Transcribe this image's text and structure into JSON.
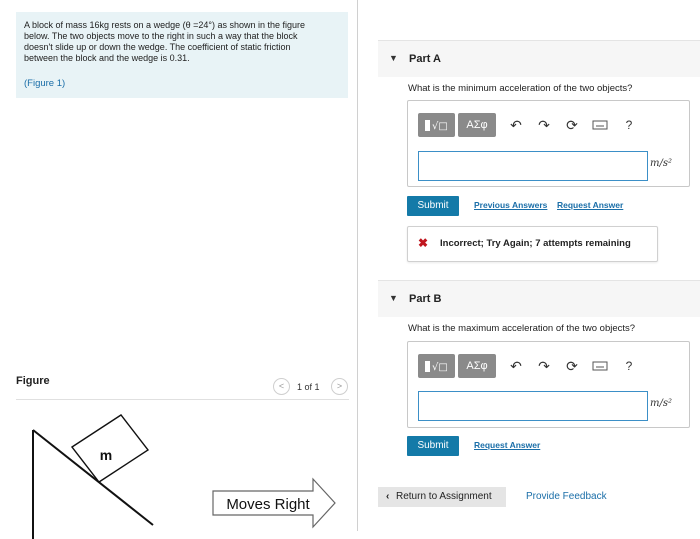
{
  "problem": {
    "text_lines": [
      "A block of mass 16kg rests on a wedge (θ =24°) as shown in the figure",
      "below.  The two objects move to the right in such a way that the block",
      "doesn't slide up or down the wedge.  The coefficient of static friction",
      "between the block and the wedge is 0.31."
    ],
    "figure_link": "(Figure 1)"
  },
  "toolbar": {
    "templates_icon": "templates-icon",
    "greek_label": "ΑΣφ",
    "undo_icon": "undo-icon",
    "redo_icon": "redo-icon",
    "reset_icon": "reset-icon",
    "keyboard_icon": "keyboard-icon",
    "help_label": "?"
  },
  "part_a": {
    "title": "Part A",
    "question": "What is the minimum acceleration of the two objects?",
    "unit": "m/s²",
    "input_value": "",
    "submit_label": "Submit",
    "previous_answers": "Previous Answers",
    "request_answer": "Request Answer",
    "feedback_mark": "✖",
    "feedback_text": "Incorrect; Try Again; 7 attempts remaining"
  },
  "part_b": {
    "title": "Part B",
    "question": "What is the maximum acceleration of the two objects?",
    "unit": "m/s²",
    "input_value": "",
    "submit_label": "Submit",
    "request_answer": "Request Answer"
  },
  "figure": {
    "label": "Figure",
    "pager": "1 of 1",
    "prev_label": "<",
    "next_label": ">",
    "block_label": "m",
    "arrow_label": "Moves Right"
  },
  "footer": {
    "return_label": "Return to Assignment",
    "feedback_label": "Provide Feedback"
  },
  "colors": {
    "accent": "#147aa8",
    "link": "#1a6ea8",
    "error": "#c0161f",
    "problem_bg": "#e8f3f6"
  }
}
